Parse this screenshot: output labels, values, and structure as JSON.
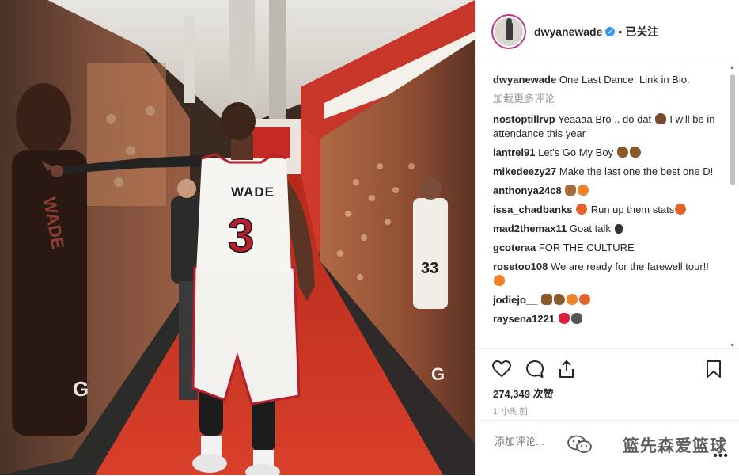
{
  "post": {
    "username": "dwyanewade",
    "verified_icon": "verified-badge-icon",
    "follow_label": "已关注",
    "dot": "•",
    "likes": "274,349 次赞",
    "time": "1 小时前",
    "add_comment_placeholder": "添加评论...",
    "more_label": "•••",
    "load_more": "加载更多评论",
    "caption": {
      "user": "dwyanewade",
      "text": "One Last Dance. Link in Bio."
    }
  },
  "photo": {
    "jersey_name": "WADE",
    "jersey_number": "3",
    "right_wall_number": "33",
    "wall_logo": "G",
    "left_wall_name": "WADE"
  },
  "comments": [
    {
      "user": "nostoptillrvp",
      "text": "Yeaaaa Bro .. do dat",
      "emoji": [
        "poop"
      ],
      "text2": "I will be in attendance this year"
    },
    {
      "user": "lantrel91",
      "text": "Let's Go My Boy",
      "emoji": [
        "muscle",
        "muscle"
      ],
      "text2": ""
    },
    {
      "user": "mikedeezy27",
      "text": "Make the last one the best one D!",
      "emoji": [],
      "text2": ""
    },
    {
      "user": "anthonya24c8",
      "text": "",
      "emoji": [
        "fist",
        "fire"
      ],
      "text2": ""
    },
    {
      "user": "issa_chadbanks",
      "text": "",
      "emoji": [
        "ball"
      ],
      "text2": "Run up them stats",
      "emoji2": [
        "ball"
      ]
    },
    {
      "user": "mad2themax11",
      "text": "Goat talk",
      "emoji": [
        "speak"
      ],
      "text2": ""
    },
    {
      "user": "gcoteraa",
      "text": "FOR THE CULTURE",
      "emoji": [],
      "text2": ""
    },
    {
      "user": "rosetoo108",
      "text": "We are ready for the farewell tour!!",
      "emoji": [
        "fire"
      ],
      "text2": ""
    },
    {
      "user": "jodiejo__",
      "text": "",
      "emoji": [
        "hands",
        "muscle",
        "fire",
        "ball"
      ],
      "text2": ""
    },
    {
      "user": "raysena1221",
      "text": "",
      "emoji": [
        "heart",
        "gorilla"
      ],
      "text2": ""
    }
  ],
  "watermark": {
    "text": "篮先森爱篮球"
  },
  "icons": {
    "like": "heart-outline-icon",
    "comment": "comment-bubble-icon",
    "share": "share-upload-icon",
    "save": "bookmark-icon",
    "more": "more-options-icon"
  },
  "colors": {
    "story_ring": "#c13584",
    "verified": "#3897f0",
    "jersey_red": "#b4202e",
    "carpet": "#c9301f"
  }
}
